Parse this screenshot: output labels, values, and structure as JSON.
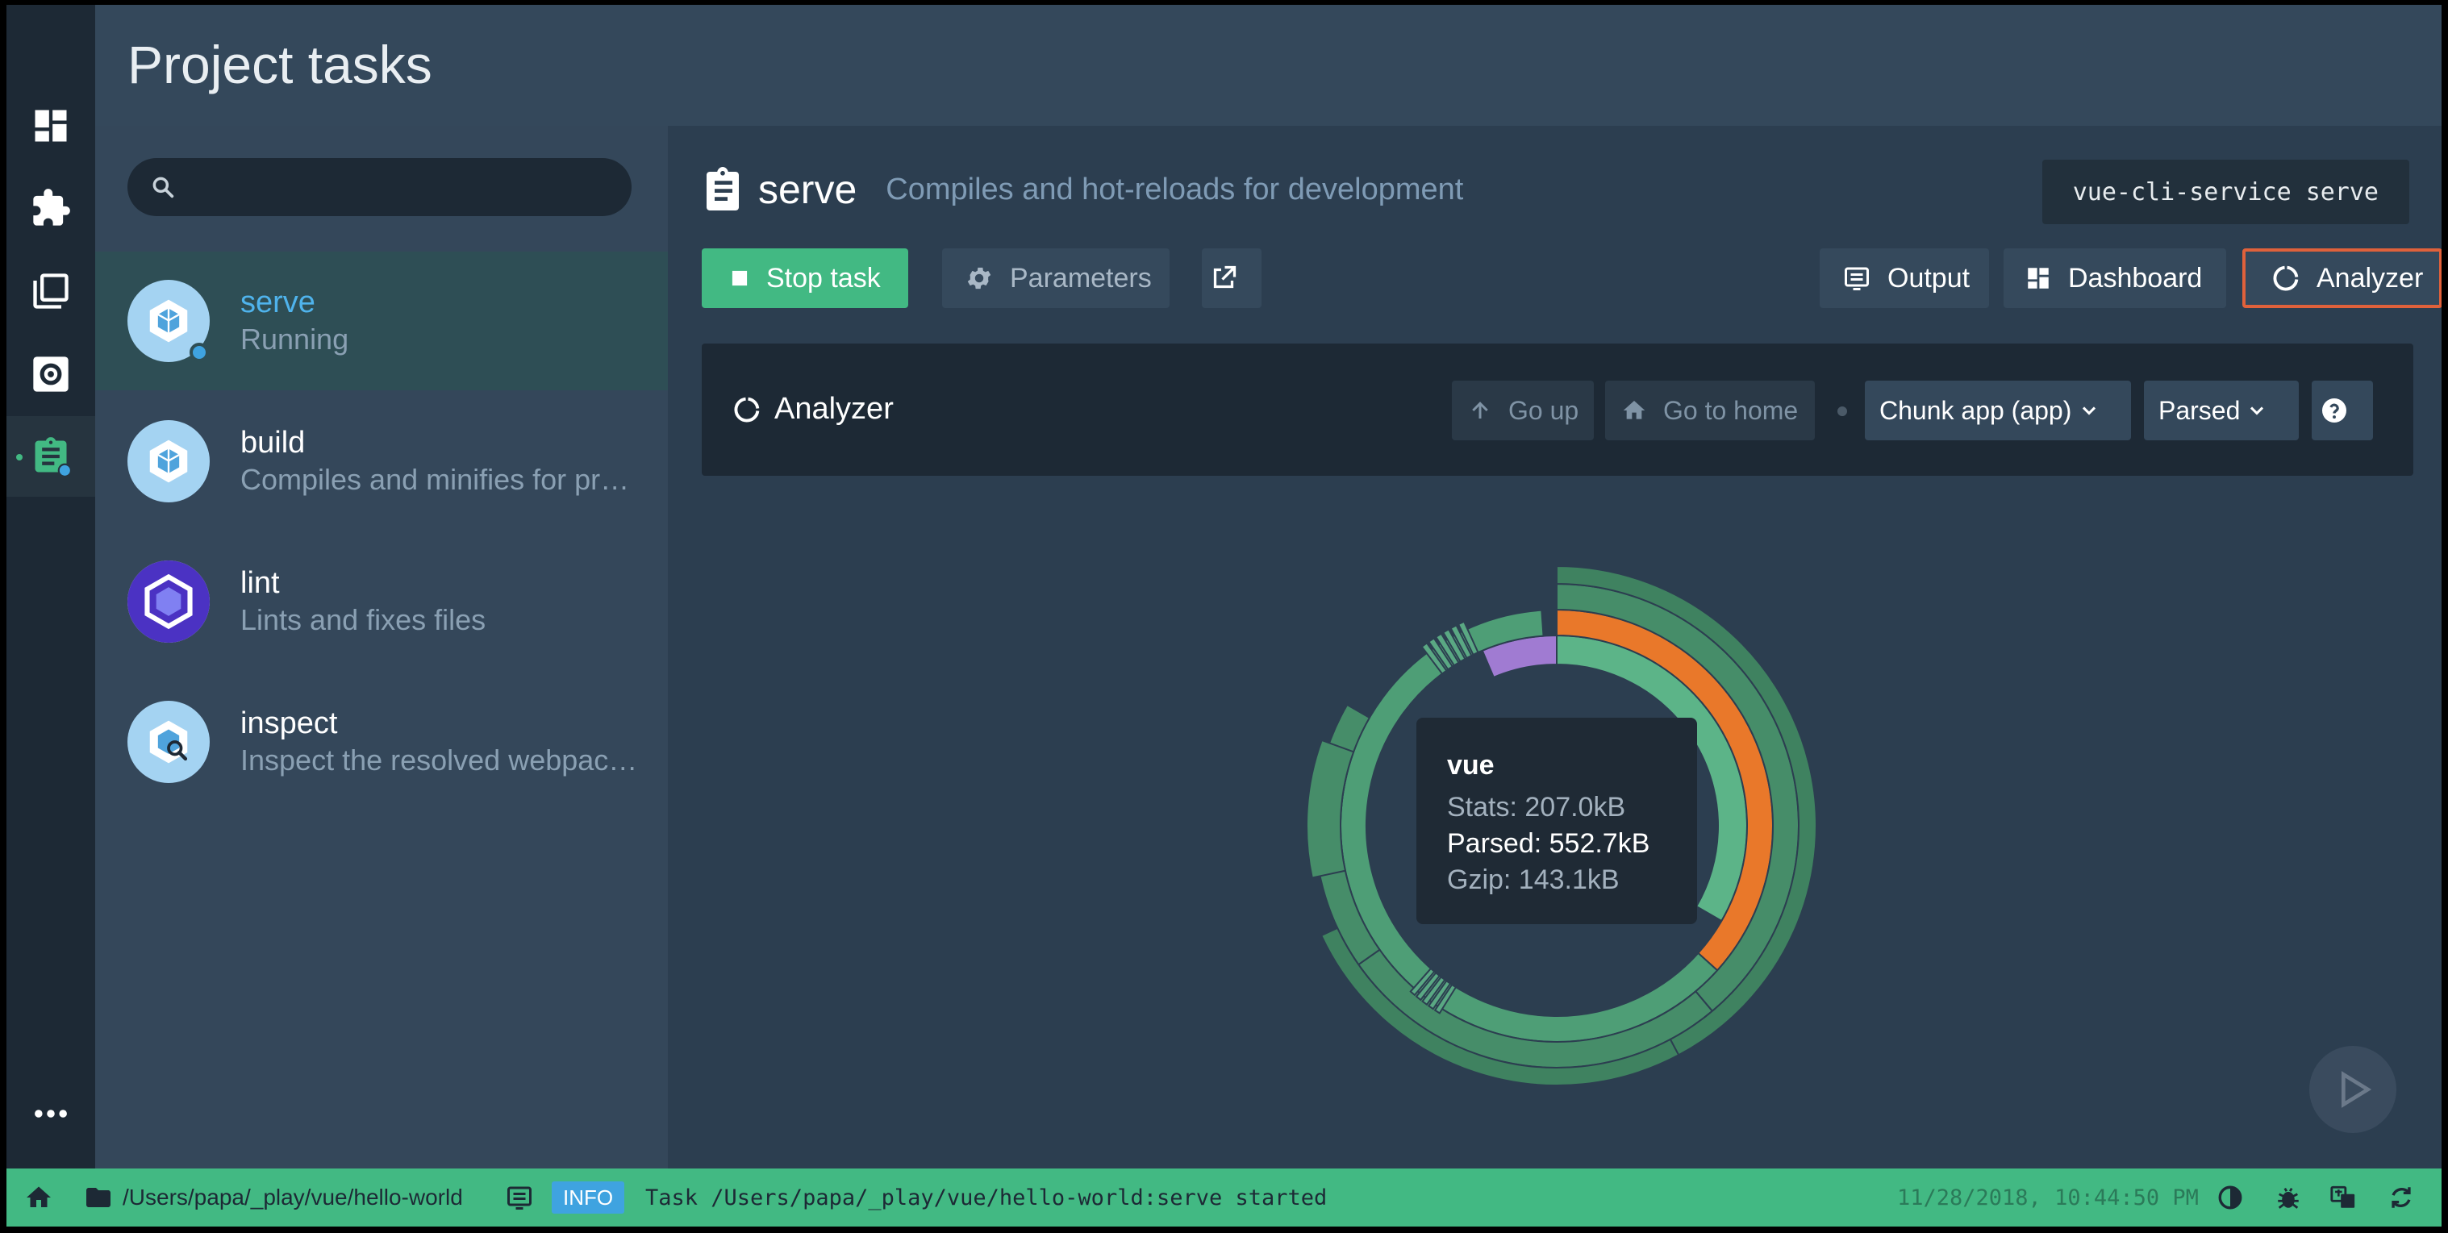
{
  "app": {
    "header_title": "Project tasks"
  },
  "search": {
    "placeholder": ""
  },
  "tasks": [
    {
      "name": "serve",
      "desc": "Running"
    },
    {
      "name": "build",
      "desc": "Compiles and minifies for production"
    },
    {
      "name": "lint",
      "desc": "Lints and fixes files"
    },
    {
      "name": "inspect",
      "desc": "Inspect the resolved webpack config"
    }
  ],
  "task_detail": {
    "title": "serve",
    "description": "Compiles and hot-reloads for development",
    "command": "vue-cli-service serve",
    "stop_label": "Stop task",
    "parameters_label": "Parameters",
    "output_label": "Output",
    "dashboard_label": "Dashboard",
    "analyzer_label": "Analyzer"
  },
  "analyzer": {
    "title": "Analyzer",
    "go_up": "Go up",
    "go_home": "Go to home",
    "chunk_select": "Chunk app (app)",
    "size_select": "Parsed"
  },
  "tooltip": {
    "name": "vue",
    "stats": "Stats: 207.0kB",
    "parsed": "Parsed: 552.7kB",
    "gzip": "Gzip: 143.1kB"
  },
  "statusbar": {
    "path": "/Users/papa/_play/vue/hello-world",
    "level": "INFO",
    "message": "Task /Users/papa/_play/vue/hello-world:serve started",
    "timestamp": "11/28/2018, 10:44:50 PM"
  },
  "colors": {
    "accent": "#42b983",
    "highlight": "#e0613b",
    "running": "#3fa3e0",
    "sunburst_green": "#47906a",
    "sunburst_orange": "#e9782a",
    "sunburst_purple": "#a07bd2"
  }
}
